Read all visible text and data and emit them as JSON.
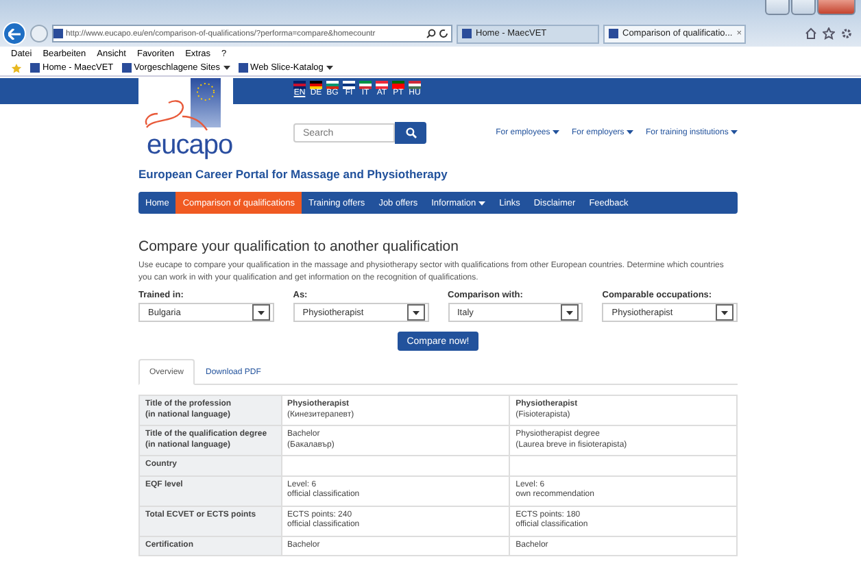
{
  "browser": {
    "address": "http://www.eucapo.eu/en/comparison-of-qualifications/?performa=compare&homecountr",
    "tabs": [
      {
        "title": "Home - MaecVET",
        "selected": false
      },
      {
        "title": "Comparison of qualificatio...",
        "selected": true
      }
    ],
    "tab_close": "×",
    "menu": [
      "Datei",
      "Bearbeiten",
      "Ansicht",
      "Favoriten",
      "Extras",
      "?"
    ],
    "favorites": [
      {
        "label": "Home - MaecVET",
        "dropdown": false
      },
      {
        "label": "Vorgeschlagene Sites",
        "dropdown": true
      },
      {
        "label": "Web Slice-Katalog",
        "dropdown": true
      }
    ]
  },
  "page": {
    "languages": [
      {
        "code": "EN",
        "selected": true
      },
      {
        "code": "DE",
        "selected": false
      },
      {
        "code": "BG",
        "selected": false
      },
      {
        "code": "FI",
        "selected": false
      },
      {
        "code": "IT",
        "selected": false
      },
      {
        "code": "AT",
        "selected": false
      },
      {
        "code": "PT",
        "selected": false
      },
      {
        "code": "HU",
        "selected": false
      }
    ],
    "logo_text": "eucapo",
    "search": {
      "placeholder": "Search"
    },
    "top_links": [
      "For employees",
      "For employers",
      "For training institutions"
    ],
    "site_title": "European Career Portal for Massage and Physiotherapy",
    "nav": [
      {
        "label": "Home",
        "selected": false,
        "dropdown": false
      },
      {
        "label": "Comparison of qualifications",
        "selected": true,
        "dropdown": false
      },
      {
        "label": "Training offers",
        "selected": false,
        "dropdown": false
      },
      {
        "label": "Job offers",
        "selected": false,
        "dropdown": false
      },
      {
        "label": "Information",
        "selected": false,
        "dropdown": true
      },
      {
        "label": "Links",
        "selected": false,
        "dropdown": false
      },
      {
        "label": "Disclaimer",
        "selected": false,
        "dropdown": false
      },
      {
        "label": "Feedback",
        "selected": false,
        "dropdown": false
      }
    ],
    "heading": "Compare your qualification to another qualification",
    "intro": "Use eucape to compare your qualification in the massage and physiotherapy sector with qualifications from other European countries. Determine which countries you can work in with your qualification and get information on the recognition of qualifications.",
    "filters": [
      {
        "label": "Trained in:",
        "value": "Bulgaria"
      },
      {
        "label": "As:",
        "value": "Physiotherapist"
      },
      {
        "label": "Comparison with:",
        "value": "Italy"
      },
      {
        "label": "Comparable occupations:",
        "value": "Physiotherapist"
      }
    ],
    "compare_button": "Compare now!",
    "tabs": [
      {
        "label": "Overview",
        "selected": true
      },
      {
        "label": "Download PDF",
        "selected": false
      }
    ],
    "table": {
      "rows": [
        {
          "label": "Title of the profession\n(in national language)",
          "cells": [
            "**Physiotherapist**\n(Кинезитерапевт)",
            "**Physiotherapist**\n(Fisioterapista)"
          ]
        },
        {
          "label": "Title of the qualification degree\n(in national language)",
          "cells": [
            "Bachelor\n(Бакалавър)",
            "Physiotherapist degree\n(Laurea breve in fisioterapista)"
          ]
        },
        {
          "label": "Country",
          "cells": []
        },
        {
          "label": "EQF level",
          "cells": [
            "Level: 6\nofficial classification",
            "Level: 6\nown recommendation"
          ]
        },
        {
          "label": "Total ECVET or ECTS points",
          "cells": [
            "ECTS points: 240\nofficial classification",
            "ECTS points: 180\nofficial classification"
          ]
        },
        {
          "label": "Certification",
          "cells": [
            "Bachelor",
            "Bachelor"
          ]
        }
      ]
    }
  }
}
